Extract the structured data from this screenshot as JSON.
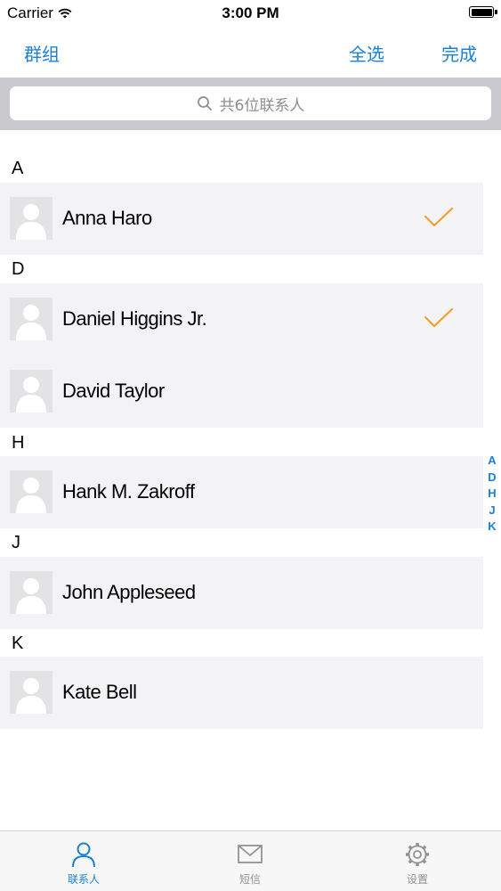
{
  "status_bar": {
    "carrier": "Carrier",
    "time": "3:00 PM"
  },
  "nav": {
    "left": "群组",
    "select_all": "全选",
    "done": "完成"
  },
  "search": {
    "placeholder": "共6位联系人"
  },
  "sections": [
    {
      "letter": "A",
      "contacts": [
        {
          "name": "Anna Haro",
          "checked": true
        }
      ]
    },
    {
      "letter": "D",
      "contacts": [
        {
          "name": "Daniel Higgins Jr.",
          "checked": true
        },
        {
          "name": "David Taylor",
          "checked": false
        }
      ]
    },
    {
      "letter": "H",
      "contacts": [
        {
          "name": "Hank M. Zakroff",
          "checked": false
        }
      ]
    },
    {
      "letter": "J",
      "contacts": [
        {
          "name": "John Appleseed",
          "checked": false
        }
      ]
    },
    {
      "letter": "K",
      "contacts": [
        {
          "name": "Kate Bell",
          "checked": false
        }
      ]
    }
  ],
  "index": [
    "A",
    "D",
    "H",
    "J",
    "K"
  ],
  "tabs": [
    {
      "label": "联系人",
      "icon": "person-icon",
      "selected": true
    },
    {
      "label": "短信",
      "icon": "envelope-icon",
      "selected": false
    },
    {
      "label": "设置",
      "icon": "gear-icon",
      "selected": false
    }
  ],
  "colors": {
    "accent": "#1a7fd6",
    "check": "#f0a030",
    "row_background": "#f3f3f5"
  }
}
